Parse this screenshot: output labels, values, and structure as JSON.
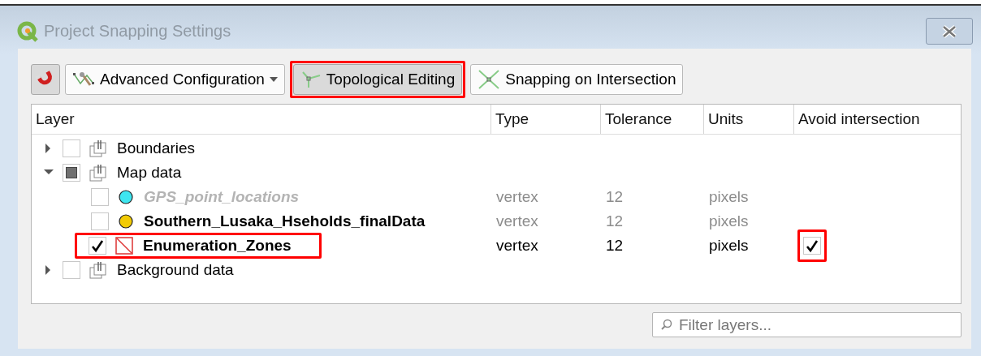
{
  "window": {
    "title": "Project Snapping Settings",
    "active": false
  },
  "toolbar": [
    {
      "kind": "magnet",
      "pressed": true,
      "highlighted": false
    },
    {
      "kind": "advanced",
      "label": "Advanced Configuration",
      "pressed": false,
      "highlighted": false
    },
    {
      "kind": "topological",
      "label": "Topological Editing",
      "pressed": true,
      "highlighted": true
    },
    {
      "kind": "intersection",
      "label": "Snapping on Intersection",
      "pressed": false,
      "highlighted": false
    }
  ],
  "table": {
    "columns": [
      "Layer",
      "Type",
      "Tolerance",
      "Units",
      "Avoid intersection"
    ],
    "rows": [
      {
        "kind": "group",
        "name": "Boundaries",
        "expanded": false,
        "checked": false,
        "partial": false,
        "children": []
      },
      {
        "kind": "group",
        "name": "Map data",
        "expanded": true,
        "checked": false,
        "partial": true,
        "children": [
          {
            "kind": "point",
            "name": "GPS_point_locations",
            "color": "#3ee6f0",
            "checked": false,
            "disabled": true,
            "type": "vertex",
            "tolerance": "12",
            "units": "pixels",
            "highlighted": false
          },
          {
            "kind": "point",
            "name": "Southern_Lusaka_Hseholds_finalData",
            "color": "#f2cb05",
            "checked": false,
            "disabled": false,
            "type": "vertex",
            "tolerance": "12",
            "units": "pixels",
            "highlighted": false
          },
          {
            "kind": "polygon",
            "name": "Enumeration_Zones",
            "checked": true,
            "disabled": false,
            "type": "vertex",
            "tolerance": "12",
            "units": "pixels",
            "avoid_intersection": true,
            "highlighted": true
          }
        ]
      },
      {
        "kind": "group",
        "name": "Background data",
        "expanded": false,
        "checked": false,
        "partial": false,
        "children": []
      }
    ]
  },
  "filter": {
    "placeholder": "Filter layers..."
  }
}
